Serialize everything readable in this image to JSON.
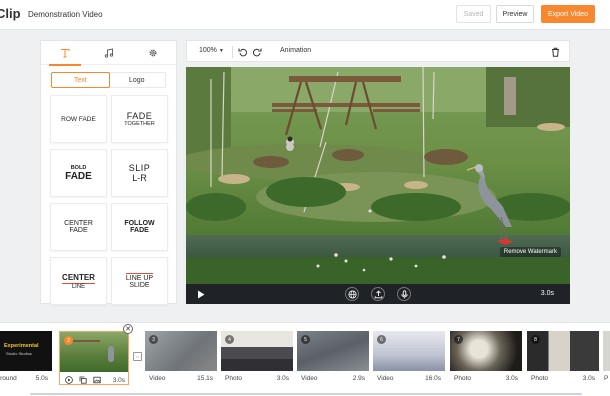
{
  "header": {
    "logo_text": "Clip",
    "project_title": "Demonstration Video",
    "saved_label": "Saved",
    "preview_label": "Preview",
    "export_label": "Export Video"
  },
  "panel": {
    "tool_tabs": [
      {
        "icon": "text-icon",
        "active": true
      },
      {
        "icon": "music-icon",
        "active": false
      },
      {
        "icon": "gear-icon",
        "active": false
      }
    ],
    "segments": {
      "text": "Text",
      "logo": "Logo",
      "active": "Text"
    },
    "animations": [
      {
        "line1": "ROW FADE",
        "line2": ""
      },
      {
        "line1": "FADE",
        "line2": "TOGETHER"
      },
      {
        "line1": "BOLD",
        "line2": "FADE"
      },
      {
        "line1": "SLIP",
        "line2": "L-R"
      },
      {
        "line1": "CENTER",
        "line2": "FADE"
      },
      {
        "line1": "FOLLOW",
        "line2": "FADE"
      },
      {
        "line1": "CENTER",
        "line2": "LINE"
      },
      {
        "line1": "LINE UP",
        "line2": "SLIDE"
      }
    ]
  },
  "editor": {
    "zoom": "100%",
    "mode_label": "Animation",
    "watermark": "Remove Watermark",
    "duration": "3.0s"
  },
  "timeline": {
    "clips": [
      {
        "type": "Background",
        "duration": "5.0s",
        "number": "",
        "caption_title": "Experimental",
        "caption_sub": "Studio Studios"
      },
      {
        "type": "",
        "duration": "3.0s",
        "number": "2",
        "selected": true
      },
      {
        "type": "Video",
        "duration": "15.1s",
        "number": "3"
      },
      {
        "type": "Photo",
        "duration": "3.0s",
        "number": "4"
      },
      {
        "type": "Video",
        "duration": "2.9s",
        "number": "5"
      },
      {
        "type": "Video",
        "duration": "16.0s",
        "number": "6"
      },
      {
        "type": "Photo",
        "duration": "3.0s",
        "number": "7"
      },
      {
        "type": "Photo",
        "duration": "3.0s",
        "number": "8"
      },
      {
        "type": "P",
        "duration": "",
        "number": ""
      }
    ]
  },
  "colors": {
    "accent": "#f7882f",
    "control_bar": "#1f2226"
  }
}
